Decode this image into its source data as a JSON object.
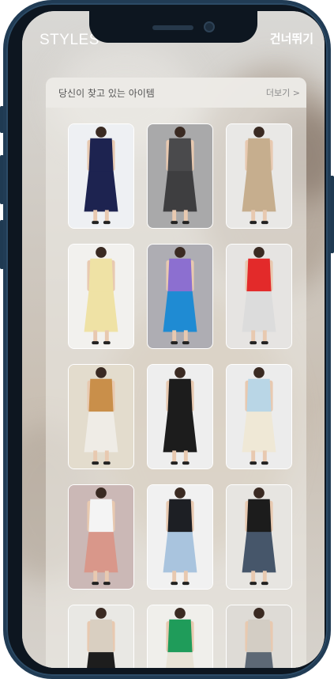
{
  "header": {
    "brand": "STYLES",
    "skip_label": "건너뛰기"
  },
  "section": {
    "title": "당신이 찾고 있는 아이템",
    "more_label": "더보기 >"
  },
  "items": [
    {
      "name": "navy-dress",
      "bg": "#eef0f3",
      "top": "#1d2350",
      "bottom": "#1d2350"
    },
    {
      "name": "grey-suit",
      "bg": "#a9a9aa",
      "top": "#4a4a4c",
      "bottom": "#3e3e40"
    },
    {
      "name": "beige-dress",
      "bg": "#e9e8e6",
      "top": "#c6ae8e",
      "bottom": "#c6ae8e"
    },
    {
      "name": "yellow-dress",
      "bg": "#f2f1ee",
      "top": "#efe2a5",
      "bottom": "#efe2a5"
    },
    {
      "name": "purple-knit-blue-skirt",
      "bg": "#aeadb3",
      "top": "#8c6fd0",
      "bottom": "#1f8bd3"
    },
    {
      "name": "red-top-white-skirt",
      "bg": "#e6e4e2",
      "top": "#e32a2a",
      "bottom": "#dcdcdc"
    },
    {
      "name": "collar-blouse-lace-skirt",
      "bg": "#e3dccd",
      "top": "#c98f4a",
      "bottom": "#efece6"
    },
    {
      "name": "black-dress",
      "bg": "#eeeeee",
      "top": "#1c1c1c",
      "bottom": "#1c1c1c"
    },
    {
      "name": "blue-tweed-jacket",
      "bg": "#ececec",
      "top": "#b9d6e6",
      "bottom": "#efe8d6"
    },
    {
      "name": "floral-skirt",
      "bg": "#cbb8b6",
      "top": "#f4f4f4",
      "bottom": "#d9978a"
    },
    {
      "name": "black-long-coat",
      "bg": "#f1f1f1",
      "top": "#1d1f24",
      "bottom": "#a9c4de"
    },
    {
      "name": "black-cardigan-jeans",
      "bg": "#e7e5e1",
      "top": "#1c1c1c",
      "bottom": "#46566a"
    },
    {
      "name": "jacket-black-skirt",
      "bg": "#e9e8e4",
      "top": "#d9cfc1",
      "bottom": "#1d1d1d"
    },
    {
      "name": "green-top-white-pants",
      "bg": "#f0efeb",
      "top": "#1f9c5a",
      "bottom": "#e8e3d6"
    },
    {
      "name": "grey-skirt",
      "bg": "#dedbd6",
      "top": "#d3cdc4",
      "bottom": "#5d6875"
    }
  ]
}
